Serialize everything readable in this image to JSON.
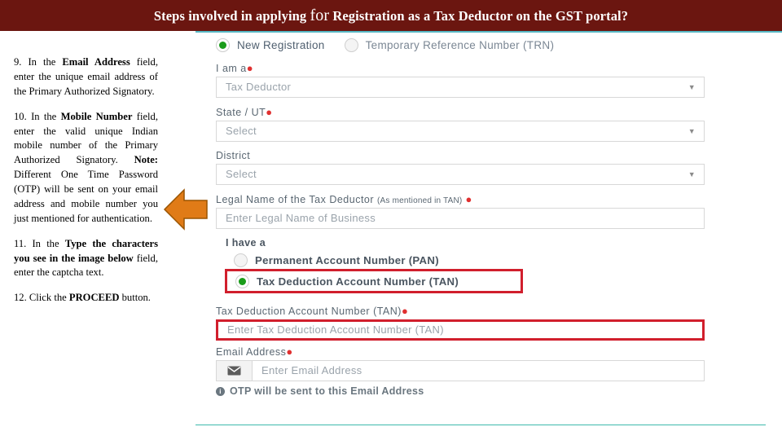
{
  "header": {
    "title_part1": "Steps involved in applying ",
    "title_for": "for",
    "title_part2": " Registration as a Tax Deductor on the GST portal?",
    "bg_color": "#6B1610",
    "text_color": "#FFFFFF",
    "accent_line_color": "#56b7c4"
  },
  "instructions": [
    {
      "id": "step-9",
      "number": "9.",
      "text_before": " In the ",
      "bold": "Email Address",
      "text_after": " field, enter the unique email address of the Primary Authorized Signatory."
    },
    {
      "id": "step-10",
      "number": "10.",
      "text_before": " In the ",
      "bold": "Mobile Number",
      "text_after": " field, enter the valid unique Indian mobile number of the Primary Authorized Signatory.",
      "note_bold": "Note:",
      "note_text": " Different One Time Password (OTP) will be sent on your email address and mobile number you just mentioned for authentication."
    },
    {
      "id": "step-11",
      "number": "11.",
      "text_before": " In the ",
      "bold": "Type the characters you see in the image below",
      "text_after": " field, enter the captcha text."
    },
    {
      "id": "step-12",
      "number": "12.",
      "text_before": " Click the ",
      "bold": "PROCEED",
      "text_after": " button."
    }
  ],
  "arrow": {
    "name": "orange-left-arrow",
    "color": "#E07B17",
    "stroke": "#9A5400",
    "direction": "left"
  },
  "form": {
    "registration_type": {
      "options": [
        {
          "label": "New Registration",
          "checked": true
        },
        {
          "label": "Temporary Reference Number (TRN)",
          "checked": false
        }
      ]
    },
    "i_am_a": {
      "label": "I am a",
      "required": true,
      "value": "Tax Deductor"
    },
    "state_ut": {
      "label": "State / UT",
      "required": true,
      "value": "Select"
    },
    "district": {
      "label": "District",
      "required": false,
      "value": "Select"
    },
    "legal_name": {
      "label": "Legal Name of the Tax Deductor",
      "sublabel": "(As mentioned in TAN)",
      "required": true,
      "placeholder": "Enter Legal Name of Business",
      "value": ""
    },
    "i_have_a": {
      "label": "I have a",
      "options": [
        {
          "label": "Permanent Account Number (PAN)",
          "checked": false,
          "highlighted": false
        },
        {
          "label": "Tax Deduction Account Number (TAN)",
          "checked": true,
          "highlighted": true
        }
      ]
    },
    "tan_field": {
      "label": "Tax Deduction Account Number (TAN)",
      "required": true,
      "placeholder": "Enter Tax Deduction Account Number (TAN)",
      "value": "",
      "highlighted": true
    },
    "email_field": {
      "label": "Email Address",
      "required": true,
      "placeholder": "Enter Email Address",
      "value": "",
      "icon": "envelope-icon"
    },
    "otp_note": "OTP will be sent to this Email Address",
    "highlight_color": "#d11f2d",
    "required_marker_color": "#e03030",
    "radio_selected_color": "#1a9c1a"
  }
}
